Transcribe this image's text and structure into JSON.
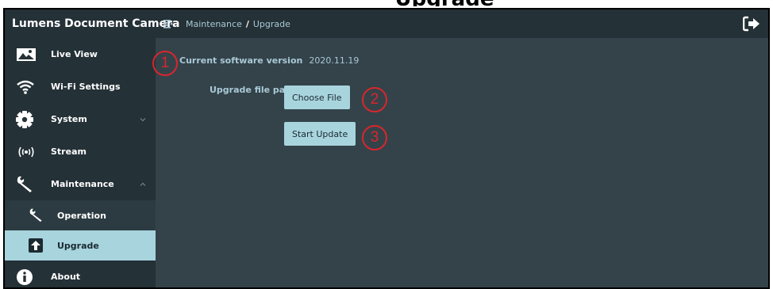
{
  "page_heading_fragment": "Upgrade",
  "app": {
    "title": "Lumens Document Camera"
  },
  "breadcrumb": {
    "parent": "Maintenance",
    "separator": "/",
    "current": "Upgrade"
  },
  "sidebar": {
    "items": [
      {
        "label": "Live View",
        "icon": "image-icon"
      },
      {
        "label": "Wi-Fi Settings",
        "icon": "wifi-icon"
      },
      {
        "label": "System",
        "icon": "gear-icon",
        "expandable": true
      },
      {
        "label": "Stream",
        "icon": "broadcast-icon"
      },
      {
        "label": "Maintenance",
        "icon": "wrench-icon",
        "expanded": true
      },
      {
        "label": "About",
        "icon": "info-icon"
      }
    ],
    "subitems": [
      {
        "label": "Operation",
        "icon": "wrench-icon"
      },
      {
        "label": "Upgrade",
        "icon": "upload-icon",
        "active": true
      }
    ]
  },
  "main": {
    "software_version_label": "Current software version",
    "software_version_value": "2020.11.19",
    "upgrade_path_label": "Upgrade file path",
    "choose_file_label": "Choose File",
    "start_update_label": "Start Update"
  },
  "callouts": [
    "1",
    "2",
    "3"
  ],
  "colors": {
    "sidebar_bg": "#243137",
    "content_bg": "#34434a",
    "accent": "#a8d4de",
    "label_text": "#a9c9d6",
    "callout": "#d9262c"
  }
}
